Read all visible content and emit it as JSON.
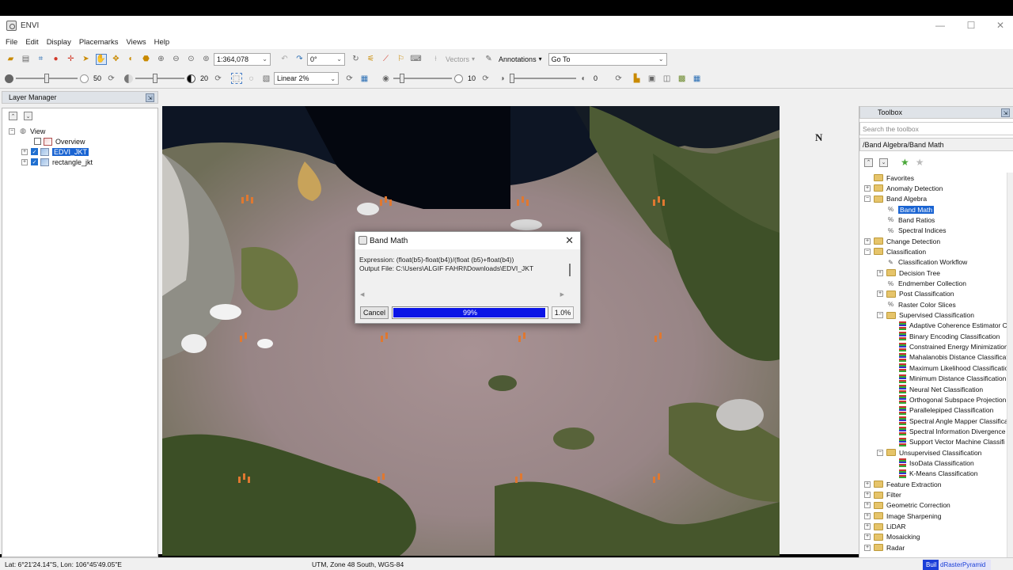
{
  "window": {
    "title": "ENVI",
    "controls": {
      "minimize": "—",
      "maximize": "☐",
      "close": "✕"
    }
  },
  "menu": [
    "File",
    "Edit",
    "Display",
    "Placemarks",
    "Views",
    "Help"
  ],
  "toolbar1": {
    "scale_value": "1:364,078",
    "rotation_value": "0°",
    "vectors_label": "Vectors",
    "annotations_label": "Annotations",
    "goto_value": "Go To"
  },
  "toolbar2": {
    "brightness_value": "50",
    "contrast_value": "20",
    "stretch_value": "Linear 2%",
    "sharpen_value": "10",
    "transparency_value": "0"
  },
  "layer_manager": {
    "title": "Layer Manager",
    "items": [
      {
        "label": "View"
      },
      {
        "label": "Overview"
      },
      {
        "label": "EDVI_JKT"
      },
      {
        "label": "rectangle_jkt"
      }
    ]
  },
  "map": {
    "north_label": "N"
  },
  "dialog": {
    "title": "Band Math",
    "expression_line": "Expression: (float(b5)-float(b4))/(float (b5)+float(b4))",
    "output_line": "Output File: C:\\Users\\ALGIF FAHRI\\Downloads\\EDVI_JKT",
    "cancel_label": "Cancel",
    "progress_text": "99%",
    "progress_fraction": 0.99,
    "rate_text": "1.0%"
  },
  "toolbox": {
    "title": "Toolbox",
    "search_placeholder": "Search the toolbox",
    "breadcrumb": "/Band Algebra/Band Math",
    "tree": [
      {
        "label": "Favorites",
        "level": 0,
        "kind": "folder",
        "exp": ""
      },
      {
        "label": "Anomaly Detection",
        "level": 0,
        "kind": "folder",
        "exp": "+"
      },
      {
        "label": "Band Algebra",
        "level": 0,
        "kind": "folder",
        "exp": "−"
      },
      {
        "label": "Band Math",
        "level": 1,
        "kind": "tool",
        "selected": true
      },
      {
        "label": "Band Ratios",
        "level": 1,
        "kind": "tool"
      },
      {
        "label": "Spectral Indices",
        "level": 1,
        "kind": "tool"
      },
      {
        "label": "Change Detection",
        "level": 0,
        "kind": "folder",
        "exp": "+"
      },
      {
        "label": "Classification",
        "level": 0,
        "kind": "folder",
        "exp": "−"
      },
      {
        "label": "Classification Workflow",
        "level": 1,
        "kind": "wand"
      },
      {
        "label": "Decision Tree",
        "level": 1,
        "kind": "folder",
        "exp": "+"
      },
      {
        "label": "Endmember Collection",
        "level": 1,
        "kind": "tool"
      },
      {
        "label": "Post Classification",
        "level": 1,
        "kind": "folder",
        "exp": "+"
      },
      {
        "label": "Raster Color Slices",
        "level": 1,
        "kind": "tool"
      },
      {
        "label": "Supervised Classification",
        "level": 1,
        "kind": "folder",
        "exp": "−"
      },
      {
        "label": "Adaptive Coherence Estimator Cl",
        "level": 2,
        "kind": "bars"
      },
      {
        "label": "Binary Encoding Classification",
        "level": 2,
        "kind": "bars"
      },
      {
        "label": "Constrained Energy Minimization",
        "level": 2,
        "kind": "bars"
      },
      {
        "label": "Mahalanobis Distance Classificat",
        "level": 2,
        "kind": "bars"
      },
      {
        "label": "Maximum Likelihood Classificatio",
        "level": 2,
        "kind": "bars"
      },
      {
        "label": "Minimum Distance Classification",
        "level": 2,
        "kind": "bars"
      },
      {
        "label": "Neural Net Classification",
        "level": 2,
        "kind": "bars"
      },
      {
        "label": "Orthogonal Subspace Projection",
        "level": 2,
        "kind": "bars"
      },
      {
        "label": "Parallelepiped Classification",
        "level": 2,
        "kind": "bars"
      },
      {
        "label": "Spectral Angle Mapper Classifica",
        "level": 2,
        "kind": "bars"
      },
      {
        "label": "Spectral Information Divergence",
        "level": 2,
        "kind": "bars"
      },
      {
        "label": "Support Vector Machine Classifi",
        "level": 2,
        "kind": "bars"
      },
      {
        "label": "Unsupervised Classification",
        "level": 1,
        "kind": "folder",
        "exp": "−"
      },
      {
        "label": "IsoData Classification",
        "level": 2,
        "kind": "bars"
      },
      {
        "label": "K-Means Classification",
        "level": 2,
        "kind": "bars"
      },
      {
        "label": "Feature Extraction",
        "level": 0,
        "kind": "folder",
        "exp": "+"
      },
      {
        "label": "Filter",
        "level": 0,
        "kind": "folder",
        "exp": "+"
      },
      {
        "label": "Geometric Correction",
        "level": 0,
        "kind": "folder",
        "exp": "+"
      },
      {
        "label": "Image Sharpening",
        "level": 0,
        "kind": "folder",
        "exp": "+"
      },
      {
        "label": "LiDAR",
        "level": 0,
        "kind": "folder",
        "exp": "+"
      },
      {
        "label": "Mosaicking",
        "level": 0,
        "kind": "folder",
        "exp": "+"
      },
      {
        "label": "Radar",
        "level": 0,
        "kind": "folder",
        "exp": "+"
      }
    ]
  },
  "status": {
    "coords": "Lat: 6°21'24.14\"S, Lon: 106°45'49.05\"E",
    "projection": "UTM, Zone 48 South, WGS-84",
    "task_prefix": "Buil",
    "task_rest": "dRasterPyramid"
  }
}
